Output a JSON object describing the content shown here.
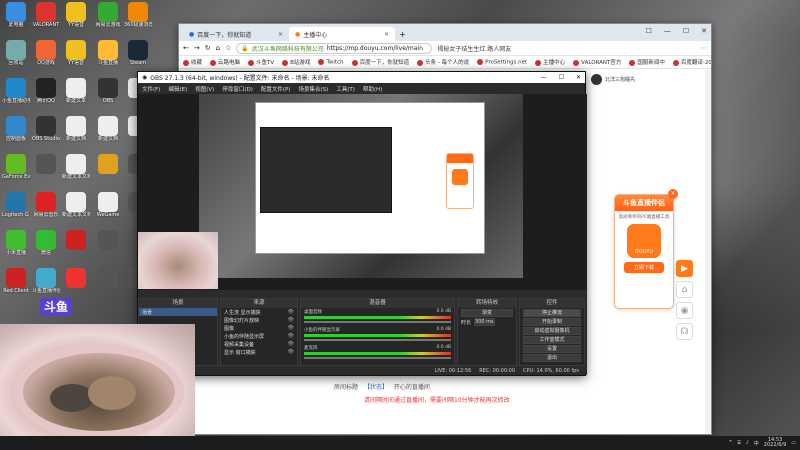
{
  "desktop": {
    "icons": [
      {
        "label": "此电脑",
        "color": "#3a8de0"
      },
      {
        "label": "VALORANT",
        "color": "#d33"
      },
      {
        "label": "YY语音",
        "color": "#f0c020"
      },
      {
        "label": "网易云游戏",
        "color": "#3a3"
      },
      {
        "label": "360极速浏览",
        "color": "#e80"
      },
      {
        "label": "回收站",
        "color": "#7aa"
      },
      {
        "label": "QQ游戏",
        "color": "#e63"
      },
      {
        "label": "YY语音",
        "color": "#f0c020"
      },
      {
        "label": "斗鱼直播",
        "color": "#fb3"
      },
      {
        "label": "Steam",
        "color": "#1b2838"
      },
      {
        "label": "小鱼直播助手",
        "color": "#28c"
      },
      {
        "label": "腾讯QQ",
        "color": "#222"
      },
      {
        "label": "新建文本",
        "color": "#eee"
      },
      {
        "label": "OBS",
        "color": "#333"
      },
      {
        "label": "",
        "color": "#eee"
      },
      {
        "label": "控制面板",
        "color": "#38c"
      },
      {
        "label": "OBS Studio",
        "color": "#333"
      },
      {
        "label": "新建文档",
        "color": "#eee"
      },
      {
        "label": "新建文档",
        "color": "#eee"
      },
      {
        "label": "",
        "color": "#eee"
      },
      {
        "label": "GeForce Experience",
        "color": "#6b2"
      },
      {
        "label": "",
        "color": "#555"
      },
      {
        "label": "新建文本文档",
        "color": "#eee"
      },
      {
        "label": "",
        "color": "#e0a020"
      },
      {
        "label": "",
        "color": "#555"
      },
      {
        "label": "Logitech G HUB",
        "color": "#27a"
      },
      {
        "label": "网易云音乐",
        "color": "#d22"
      },
      {
        "label": "新建文本文档",
        "color": "#eee"
      },
      {
        "label": "WeGame",
        "color": "#eee"
      },
      {
        "label": "",
        "color": "#555"
      },
      {
        "label": "小米直播",
        "color": "#4b3"
      },
      {
        "label": "微信",
        "color": "#3b3"
      },
      {
        "label": "",
        "color": "#c22"
      },
      {
        "label": "",
        "color": "#555"
      },
      {
        "label": "",
        "color": "#555"
      },
      {
        "label": "Red Client",
        "color": "#c22"
      },
      {
        "label": "斗鱼直播伴侣",
        "color": "#4ac"
      },
      {
        "label": "",
        "color": "#e33"
      },
      {
        "label": "",
        "color": "#555"
      },
      {
        "label": "",
        "color": "#555"
      }
    ],
    "watermark": "斗鱼"
  },
  "browser": {
    "tabs": [
      {
        "title": "百度一下，你就知道"
      },
      {
        "title": "主播中心"
      }
    ],
    "new_tab": "+",
    "window_controls": [
      "☐",
      "—",
      "☐",
      "✕"
    ],
    "url_org": "武汉斗鱼网络科技有限公司",
    "url": "https://mp.douyu.com/live/main",
    "news": "揭秘女子结生生红 路人网友",
    "bookmarks": [
      "收藏",
      "云路电脑",
      "斗鱼TV",
      "B站游戏",
      "Twitch",
      "百度一下，你就知道",
      "头条 - 每个人的说",
      "ProSettings.net",
      "主播中心",
      "VALORANT官方",
      "国服新闻中",
      "百度翻译-200种"
    ],
    "streamer_name": "北洋三狗睡先",
    "live_info_prefix": "房间标题",
    "live_info_tag": "【状态】",
    "live_info_text": "开心的直播间",
    "warn": "请间隔时间通过直播间，需要间隔10分钟才能再次修改",
    "promo": {
      "title": "斗鱼直播伴侣",
      "subtitle": "高效简单的PC端直播工具",
      "logo_text": "DOUYU",
      "download": "立即下载",
      "close": "×"
    },
    "rail_icons": [
      "play-icon",
      "home-icon",
      "camera-icon",
      "headset-icon"
    ]
  },
  "obs": {
    "title": "OBS 27.1.3 (64-bit, windows) - 配置文件: 未命名 - 场景: 未命名",
    "menu": [
      "文件(F)",
      "编辑(E)",
      "视图(V)",
      "停靠窗口(D)",
      "配置文件(P)",
      "场景集合(S)",
      "工具(T)",
      "帮助(H)"
    ],
    "docks": {
      "scenes_header": "场景",
      "scenes": [
        "场景"
      ],
      "sources_header": "来源",
      "sources": [
        "人生流 显示捕获",
        "图像幻灯片放映",
        "图像",
        "小鱼的伴随显示屏",
        "视频采集设备",
        "显示 窗口捕获"
      ],
      "mixer_header": "混音器",
      "mixer": [
        {
          "name": "桌面音频",
          "db": "0.0 dB"
        },
        {
          "name": "小鱼的伴随显示屏",
          "db": "0.0 dB"
        },
        {
          "name": "麦克风",
          "db": "0.0 dB"
        }
      ],
      "transitions_header": "转场特效",
      "transition_type": "渐变",
      "transition_duration_label": "时长",
      "transition_duration": "300 ms",
      "controls_header": "控件",
      "controls": [
        "停止推流",
        "开始录制",
        "启动虚拟摄像机",
        "工作室模式",
        "设置",
        "退出"
      ]
    },
    "status": {
      "live": "LIVE: 00:12:56",
      "rec": "REC: 00:00:00",
      "cpu": "CPU: 14.0%, 60.00 fps"
    }
  },
  "taskbar": {
    "time": "14:53",
    "date": "2022/6/9"
  }
}
